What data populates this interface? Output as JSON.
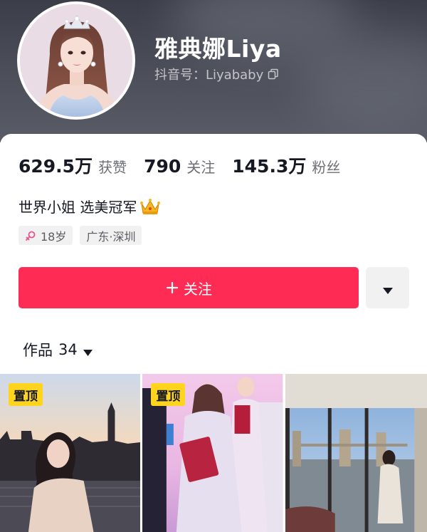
{
  "profile": {
    "name": "雅典娜Liya",
    "handle": "抖音号：Liyababy",
    "avatar_icon": "avatar-photo"
  },
  "stats": [
    {
      "value": "629.5万",
      "label": "获赞"
    },
    {
      "value": "790",
      "label": "关注"
    },
    {
      "value": "145.3万",
      "label": "粉丝"
    }
  ],
  "bio": {
    "text": "世界小姐 选美冠军",
    "emoji_icon": "crown-icon"
  },
  "tags": {
    "age": "18岁",
    "location": "广东·深圳",
    "gender_icon": "female-icon"
  },
  "actions": {
    "follow_label": "关注",
    "more_icon": "triangle-down-icon"
  },
  "works": {
    "label": "作品",
    "count": "34"
  },
  "videos": [
    {
      "badge": "置顶"
    },
    {
      "badge": "置顶"
    },
    {
      "badge": ""
    }
  ],
  "colors": {
    "accent": "#fe2c55",
    "badge": "#ffd41f",
    "header_bg": "#4a4d57"
  }
}
